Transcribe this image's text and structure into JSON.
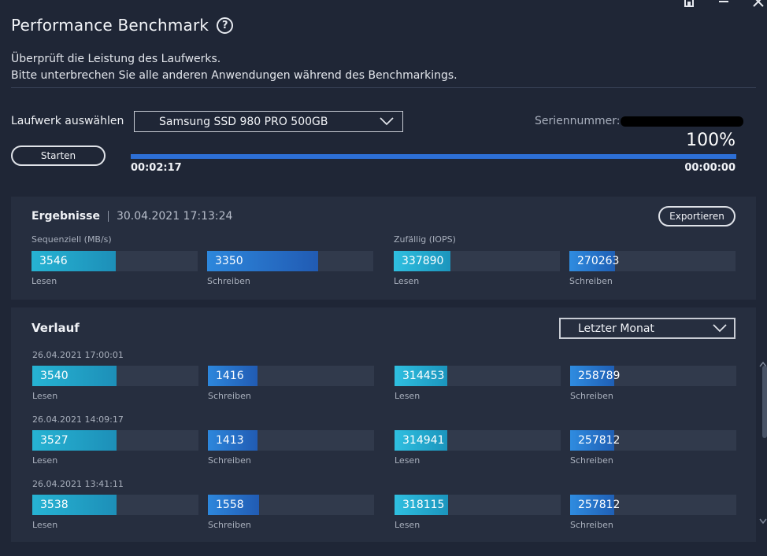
{
  "window": {
    "title": "Performance Benchmark",
    "controls": [
      "restore-icon",
      "minimize-icon",
      "close-icon"
    ]
  },
  "description": {
    "line1": "Überprüft die Leistung des Laufwerks.",
    "line2": "Bitte unterbrechen Sie alle anderen Anwendungen während des Benchmarkings."
  },
  "drive": {
    "label": "Laufwerk auswählen",
    "selected": "Samsung SSD 980 PRO 500GB",
    "serial_label": "Seriennummer:"
  },
  "run": {
    "start_label": "Starten",
    "percent": "100%",
    "progress": 1.0,
    "elapsed": "00:02:17",
    "remaining": "00:00:00"
  },
  "results": {
    "title": "Ergebnisse",
    "date": "30.04.2021 17:13:24",
    "export_label": "Exportieren",
    "seq_label": "Sequenziell (MB/s)",
    "rnd_label": "Zufällig (IOPS)",
    "seq_read": "3546",
    "seq_write": "3350",
    "rnd_read": "337890",
    "rnd_write": "270263",
    "read_caption": "Lesen",
    "write_caption": "Schreiben"
  },
  "history": {
    "title": "Verlauf",
    "period": "Letzter Monat",
    "entries": [
      {
        "date": "26.04.2021 17:00:01",
        "seq_read": "3540",
        "seq_write": "1416",
        "rnd_read": "314453",
        "rnd_write": "258789",
        "read_caption": "Lesen",
        "write_caption": "Schreiben"
      },
      {
        "date": "26.04.2021 14:09:17",
        "seq_read": "3527",
        "seq_write": "1413",
        "rnd_read": "314941",
        "rnd_write": "257812",
        "read_caption": "Lesen",
        "write_caption": "Schreiben"
      },
      {
        "date": "26.04.2021 13:41:11",
        "seq_read": "3538",
        "seq_write": "1558",
        "rnd_read": "318115",
        "rnd_write": "257812",
        "read_caption": "Lesen",
        "write_caption": "Schreiben"
      }
    ]
  },
  "colors": {
    "background": "#1f2636",
    "panel": "#262e3f",
    "accent_blue": "#2d6fd6",
    "accent_cyan": "#26b3d3"
  }
}
